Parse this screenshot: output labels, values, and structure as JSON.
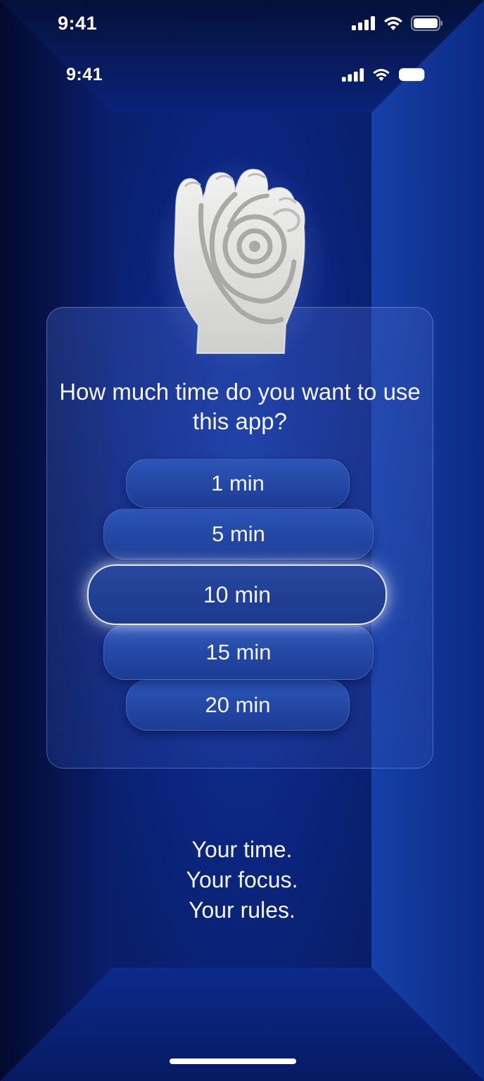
{
  "status_bar_outer": {
    "time": "9:41"
  },
  "status_bar_inner": {
    "time": "9:41"
  },
  "icons": {
    "signal": "cellular-signal-icon",
    "wifi": "wifi-icon",
    "battery": "battery-icon",
    "hand": "hand-eye-icon"
  },
  "question": "How much time do you want to use this app?",
  "picker": {
    "options": [
      "1 min",
      "5 min",
      "10 min",
      "15 min",
      "20 min"
    ],
    "selected": "10 min"
  },
  "tagline": {
    "line1": "Your time.",
    "line2": "Your focus.",
    "line3": "Your rules."
  },
  "colors": {
    "background": "#0b257e",
    "accent_glow": "#ffffff",
    "pill": "#2c55b8"
  }
}
